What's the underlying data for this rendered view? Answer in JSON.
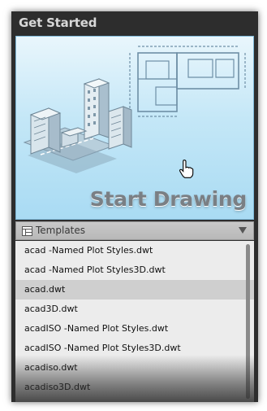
{
  "panel": {
    "title": "Get Started"
  },
  "start_tile": {
    "label": "Start Drawing"
  },
  "templates": {
    "header_label": "Templates",
    "items": [
      {
        "label": "acad -Named Plot Styles.dwt"
      },
      {
        "label": "acad -Named Plot Styles3D.dwt"
      },
      {
        "label": "acad.dwt",
        "selected": true
      },
      {
        "label": "acad3D.dwt"
      },
      {
        "label": "acadISO -Named Plot Styles.dwt"
      },
      {
        "label": "acadISO -Named Plot Styles3D.dwt"
      },
      {
        "label": "acadiso.dwt"
      },
      {
        "label": "acadiso3D.dwt"
      }
    ]
  },
  "colors": {
    "panel_bg": "#2d2d2d",
    "tile_gradient_top": "#e9f6fc",
    "tile_gradient_bottom": "#a9dbf3",
    "list_bg": "#ececec",
    "selected_row": "#cfcfcf"
  },
  "icons": [
    "template-list-icon",
    "dropdown-arrow-icon",
    "hand-pointer-icon",
    "city-blocks-illustration",
    "floor-plan-illustration"
  ]
}
